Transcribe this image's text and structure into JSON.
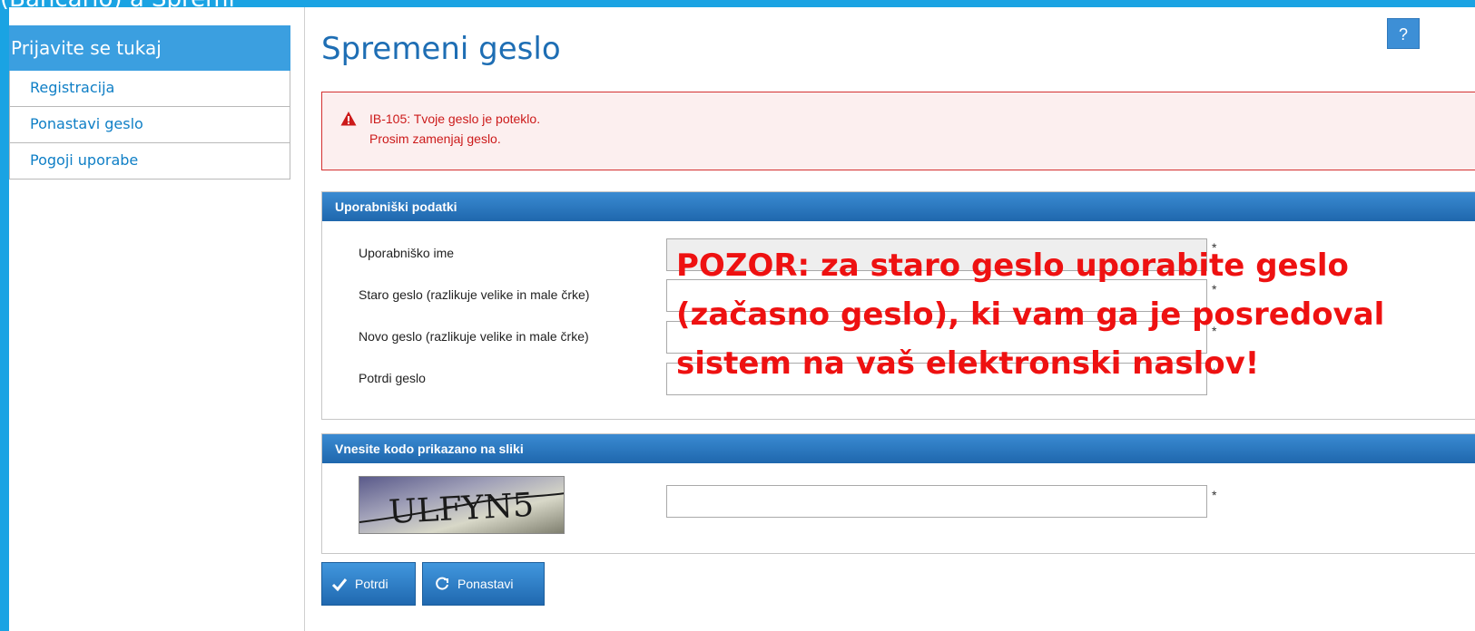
{
  "window": {
    "title_fragment": "(Bancario) a  Spremi"
  },
  "sidebar": {
    "header": "Prijavite se tukaj",
    "items": [
      {
        "label": "Registracija"
      },
      {
        "label": "Ponastavi geslo"
      },
      {
        "label": "Pogoji uporabe"
      }
    ]
  },
  "main": {
    "title": "Spremeni geslo",
    "help_label": "?",
    "alert": {
      "icon": "warning-triangle-icon",
      "line1": "IB-105: Tvoje geslo je poteklo.",
      "line2": "Prosim zamenjaj geslo."
    },
    "user_panel": {
      "header": "Uporabniški podatki",
      "fields": [
        {
          "label": "Uporabniško ime",
          "value": "",
          "required": "*"
        },
        {
          "label": "Staro geslo (razlikuje velike in male črke)",
          "value": "",
          "required": "*"
        },
        {
          "label": "Novo geslo (razlikuje velike in male črke)",
          "value": "",
          "required": "*"
        },
        {
          "label": "Potrdi geslo",
          "value": "",
          "required": "*"
        }
      ]
    },
    "captcha_panel": {
      "header": "Vnesite kodo prikazano na sliki",
      "captcha_text": "ULFYN5",
      "input_value": "",
      "required": "*"
    },
    "buttons": {
      "confirm": "Potrdi",
      "confirm_icon": "checkmark-icon",
      "reset": "Ponastavi",
      "reset_icon": "refresh-icon"
    }
  },
  "annotation": {
    "lines": [
      "POZOR: za staro geslo uporabite geslo",
      "(začasno geslo), ki vam ga je posredoval",
      "sistem na vaš elektronski naslov!"
    ],
    "color": "#ee1111"
  },
  "colors": {
    "background": "#1aa3e3",
    "accent": "#1e6eb4",
    "alert": "#cc1a1a"
  }
}
